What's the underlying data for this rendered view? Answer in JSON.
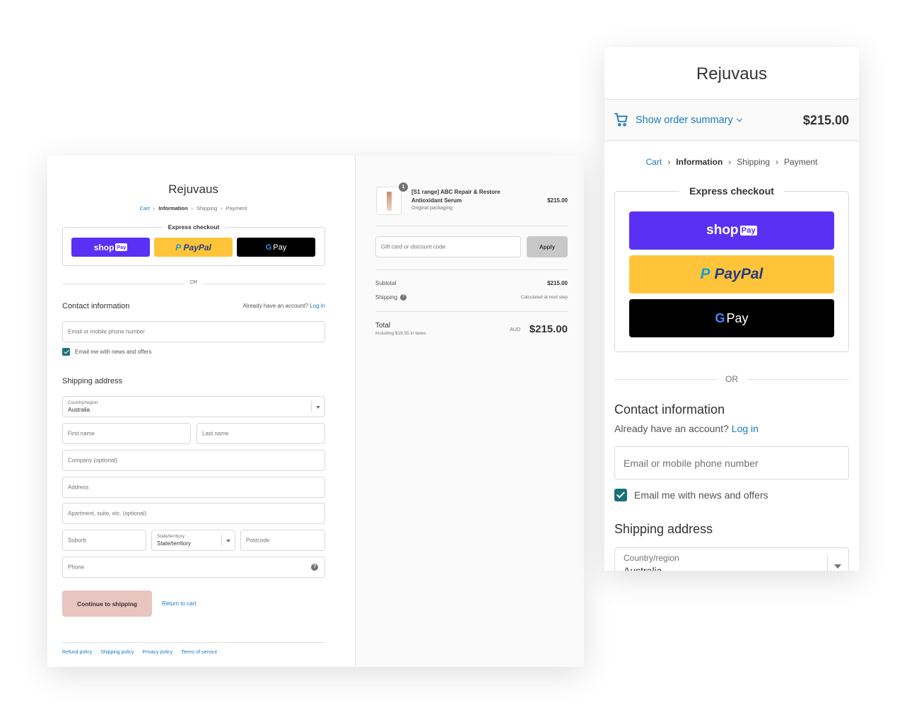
{
  "desktop": {
    "store_name": "Rejuvaus",
    "breadcrumb": [
      "Cart",
      "Information",
      "Shipping",
      "Payment"
    ],
    "express_checkout_label": "Express checkout",
    "shop_pay": {
      "word": "shop",
      "tag": "Pay"
    },
    "paypal": {
      "p": "P",
      "text": "PayPal"
    },
    "gpay": {
      "g": "G",
      "text": "Pay"
    },
    "or_label": "OR",
    "contact_heading": "Contact information",
    "account_prompt": "Already have an account?",
    "login_link": "Log in",
    "email_placeholder": "Email or mobile phone number",
    "newsletter_label": "Email me with news and offers",
    "newsletter_checked": true,
    "shipping_heading": "Shipping address",
    "country_label": "Country/region",
    "country_value": "Australia",
    "first_name_placeholder": "First name",
    "last_name_placeholder": "Last name",
    "company_placeholder": "Company (optional)",
    "address_placeholder": "Address",
    "apartment_placeholder": "Apartment, suite, etc. (optional)",
    "suburb_placeholder": "Suburb",
    "state_label": "State/territory",
    "state_value": "State/territory",
    "postcode_placeholder": "Postcode",
    "phone_placeholder": "Phone",
    "help_glyph": "?",
    "continue_button": "Continue to shipping",
    "return_link": "Return to cart",
    "footer_links": [
      "Refund policy",
      "Shipping policy",
      "Privacy policy",
      "Terms of service"
    ],
    "sidebar": {
      "product_qty": "1",
      "product_name": "[S1 range] ABC Repair & Restore Antioxidant Serum",
      "product_variant": "Original packaging",
      "product_price": "$215.00",
      "gift_placeholder": "Gift card or discount code",
      "apply_button": "Apply",
      "subtotal_label": "Subtotal",
      "subtotal_value": "$215.00",
      "shipping_label": "Shipping",
      "shipping_value": "Calculated at next step",
      "total_label": "Total",
      "tax_note": "Including $19.55 in taxes",
      "currency": "AUD",
      "total_value": "$215.00"
    }
  },
  "mobile": {
    "store_name": "Rejuvaus",
    "show_summary": "Show order summary",
    "summary_total": "$215.00",
    "breadcrumb": [
      "Cart",
      "Information",
      "Shipping",
      "Payment"
    ],
    "express_checkout_label": "Express checkout",
    "or_label": "OR",
    "contact_heading": "Contact information",
    "account_prompt": "Already have an account?",
    "login_link": "Log in",
    "email_placeholder": "Email or mobile phone number",
    "newsletter_label": "Email me with news and offers",
    "shipping_heading": "Shipping address",
    "country_label": "Country/region",
    "country_value": "Australia"
  },
  "colors": {
    "shop_pay": "#5a31f4",
    "paypal": "#ffc439",
    "gpay": "#000000",
    "link": "#197bbd",
    "checkbox": "#18707a",
    "continue_button": "#e8c5bf"
  },
  "icons": [
    "cart-icon",
    "chevron-down-icon",
    "chevron-right-icon",
    "help-icon",
    "checkmark-icon",
    "select-arrow-icon"
  ]
}
